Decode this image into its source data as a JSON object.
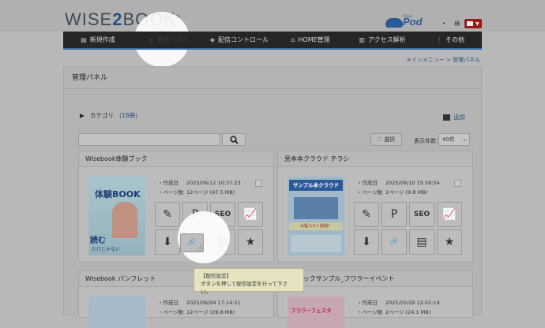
{
  "logo": {
    "text1": "WISE",
    "text2": "BOOK",
    "mark": "®"
  },
  "pod": {
    "cloud": "Cloud",
    "label": "Pod"
  },
  "user": {
    "label": "様",
    "dot": "•"
  },
  "nav": [
    {
      "label": "新規作成",
      "icon": "document-icon"
    },
    {
      "label": "管理パネル",
      "icon": "monitor-icon"
    },
    {
      "label": "配信コントロール",
      "icon": "broadcast-icon"
    },
    {
      "label": "HOME管理",
      "icon": "home-icon"
    },
    {
      "label": "アクセス解析",
      "icon": "chart-icon"
    },
    {
      "label": "その他",
      "icon": "more-icon"
    }
  ],
  "breadcrumb": {
    "home": "メインメニュー",
    "sep": ">",
    "current": "管理パネル"
  },
  "page": {
    "title": "管理パネル"
  },
  "category": {
    "label": "カテゴリ",
    "count": "(18冊)"
  },
  "add": {
    "label": "追加"
  },
  "search": {
    "placeholder": ""
  },
  "select": {
    "label": "選択"
  },
  "per_page": {
    "label": "表示件数：",
    "value": "40件"
  },
  "cards": [
    {
      "title": "Wisebook体験ブック",
      "created_label": "作成日",
      "created": "2025/06/12 10:37:23",
      "pages_label": "ページ数",
      "pages": "12ページ (47.5 MB)",
      "thumb_text1": "体験BOOK",
      "thumb_text2": "読む",
      "thumb_text3": "だけじゃない"
    },
    {
      "title": "見本本クラウド チラシ",
      "created_label": "作成日",
      "created": "2025/06/10 15:58:54",
      "pages_label": "ページ数",
      "pages": "2ページ (9.8 MB)",
      "thumb_text1": "サンプル本クラウド",
      "thumb_text2": "大幅コスト削減！"
    },
    {
      "title": "Wisebook パンフレット",
      "created_label": "作成日",
      "created": "2025/06/04 17:14:51",
      "pages_label": "ページ数",
      "pages": "12ページ (28.8 MB)"
    },
    {
      "title": "...ルブックサンプル_フワラーイベント",
      "created_label": "作成日",
      "created": "2025/05/29 12:02:19",
      "pages_label": "ページ数",
      "pages": "2ページ (24.1 MB)",
      "thumb_text1": "フラワーフェスタ"
    }
  ],
  "tooltip": {
    "line1": "【配信設定】",
    "line2": "ボタンを押して配信設定を行って下さい。"
  },
  "colors": {
    "nav_bg": "#262626",
    "accent": "#2a4e82",
    "brand_red": "#9a1a1a",
    "tooltip_bg": "#e6e3c0"
  }
}
